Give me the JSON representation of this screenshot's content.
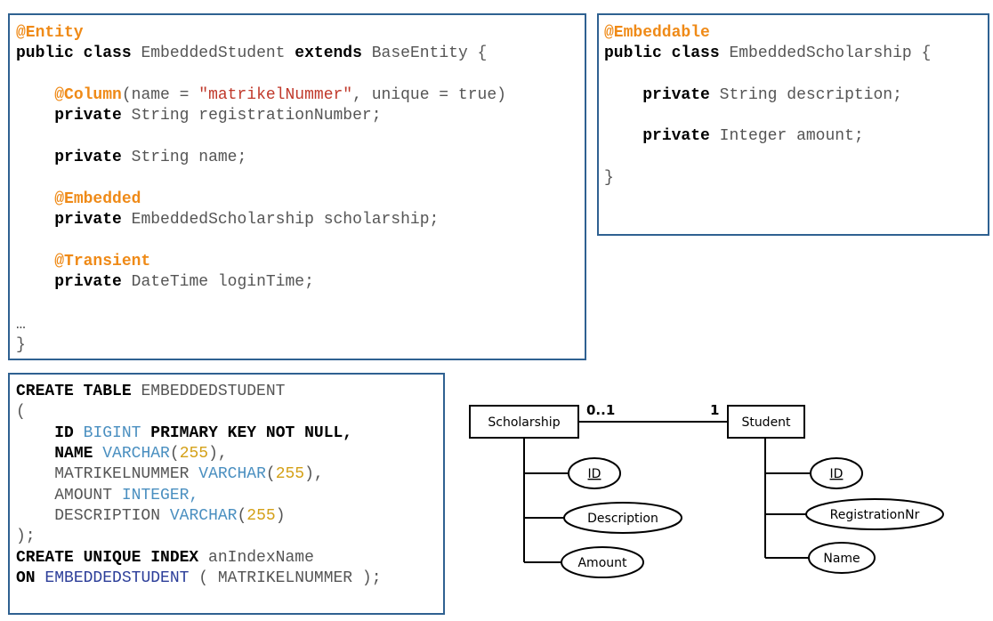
{
  "java_entity": {
    "annotation_entity": "@Entity",
    "kw_public": "public",
    "kw_class": "class",
    "class_name": "EmbeddedStudent",
    "kw_extends": "extends",
    "base_class": "BaseEntity {",
    "column_annotation": "@Column",
    "column_args_open": "(name = ",
    "column_name_string": "\"matrikelNummer\"",
    "column_args_close": ", unique = true)",
    "kw_private": "private",
    "field_registration": "String registrationNumber;",
    "field_name": "String name;",
    "annotation_embedded": "@Embedded",
    "field_scholarship": "EmbeddedScholarship scholarship;",
    "annotation_transient": "@Transient",
    "field_login": "DateTime loginTime;",
    "ellipsis": "…",
    "closing_brace": "}"
  },
  "java_embeddable": {
    "annotation": "@Embeddable",
    "kw_public": "public",
    "kw_class": "class",
    "class_name": "EmbeddedScholarship {",
    "kw_private": "private",
    "field_description": "String description;",
    "field_amount": "Integer amount;",
    "closing_brace": "}"
  },
  "sql": {
    "create_table_kw": "CREATE TABLE",
    "table_name": "EMBEDDEDSTUDENT",
    "open_paren": "(",
    "id_col": "ID",
    "bigint": "BIGINT",
    "primary_key": "PRIMARY KEY NOT NULL,",
    "name_col": "NAME",
    "varchar": "VARCHAR",
    "paren_open": "(",
    "size_255": "255",
    "paren_close_comma": "),",
    "paren_close": ")",
    "matrikel_col": "MATRIKELNUMMER",
    "amount_col": "AMOUNT",
    "integer": "INTEGER,",
    "description_col": "DESCRIPTION",
    "close_paren": ");",
    "create_index_kw": "CREATE UNIQUE INDEX",
    "index_name": "anIndexName",
    "on_kw": "ON",
    "on_table": "EMBEDDEDSTUDENT",
    "on_cols": "( MATRIKELNUMMER );"
  },
  "er": {
    "scholarship_entity": "Scholarship",
    "student_entity": "Student",
    "cardinality_scholarship": "0..1",
    "cardinality_student": "1",
    "scholarship_attrs": [
      "ID",
      "Description",
      "Amount"
    ],
    "student_attrs": [
      "ID",
      "RegistrationNr",
      "Name"
    ]
  }
}
